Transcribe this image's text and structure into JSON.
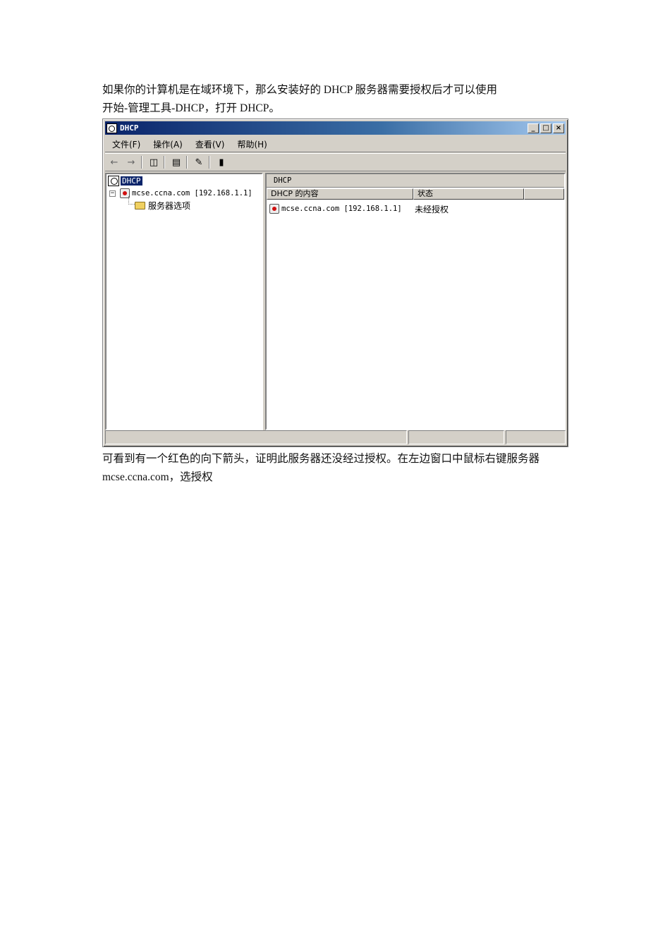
{
  "document": {
    "intro_line1": "如果你的计算机是在域环境下，那么安装好的 DHCP 服务器需要授权后才可以使用",
    "intro_line2": "开始-管理工具-DHCP，打开 DHCP。",
    "outro_line1": "可看到有一个红色的向下箭头，证明此服务器还没经过授权。在左边窗口中鼠标右键服务器",
    "outro_line2": "mcse.ccna.com，选授权"
  },
  "window": {
    "title": "DHCP",
    "controls": {
      "minimize": "_",
      "maximize": "□",
      "close": "×"
    },
    "menu": [
      "文件(F)",
      "操作(A)",
      "查看(V)",
      "帮助(H)"
    ],
    "toolbar_icons": [
      "back-arrow-icon",
      "forward-arrow-icon",
      "show-tree-icon",
      "export-list-icon",
      "help-icon",
      "server-icon"
    ]
  },
  "tree": {
    "root": "DHCP",
    "server": "mcse.ccna.com [192.168.1.1]",
    "child": "服务器选项",
    "expander": "−"
  },
  "details": {
    "header": "DHCP",
    "columns": [
      "DHCP 的内容",
      "状态",
      ""
    ],
    "rows": [
      {
        "name": "mcse.ccna.com [192.168.1.1]",
        "status": "未经授权"
      }
    ]
  }
}
